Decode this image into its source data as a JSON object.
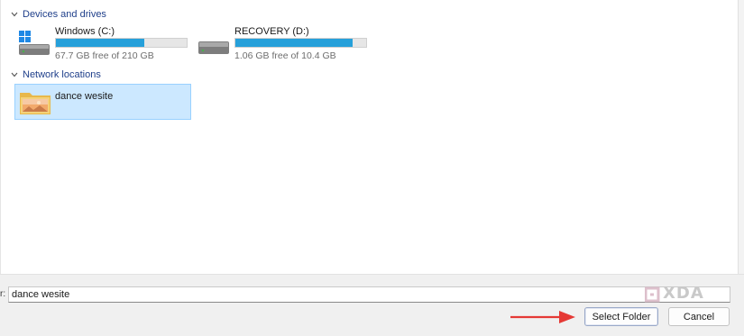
{
  "groups": {
    "devices_label": "Devices and drives",
    "network_label": "Network locations"
  },
  "drives": [
    {
      "name": "Windows (C:)",
      "free_text": "67.7 GB free of 210 GB",
      "used_fraction": 0.678,
      "icon": "windows-drive-icon"
    },
    {
      "name": "RECOVERY (D:)",
      "free_text": "1.06 GB free of 10.4 GB",
      "used_fraction": 0.898,
      "icon": "hard-drive-icon"
    }
  ],
  "network_items": [
    {
      "name": "dance wesite",
      "icon": "folder-icon"
    }
  ],
  "footer": {
    "filename_label": "r:",
    "filename_value": "dance wesite",
    "select_button": "Select Folder",
    "cancel_button": "Cancel"
  },
  "watermark": {
    "text": "XDA"
  },
  "colors": {
    "progress_fill": "#26a0da",
    "selection_bg": "#cce8ff",
    "selection_border": "#99d1ff",
    "arrow": "#e53935",
    "group_header": "#1f3f8a"
  }
}
